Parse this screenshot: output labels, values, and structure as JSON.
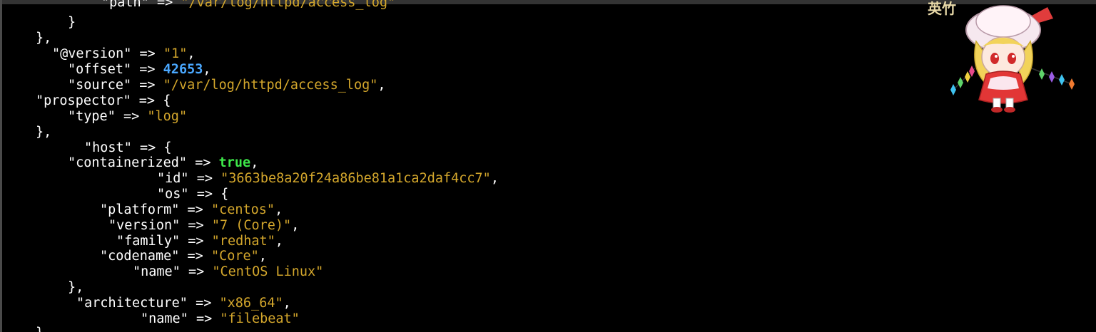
{
  "terminal": {
    "lines": [
      {
        "k": "\"path\"",
        "op": " => ",
        "v": "\"/var/log/httpd/access_log\"",
        "vt": "str",
        "p": ""
      },
      {
        "k": "}",
        "op": "",
        "v": "",
        "vt": "",
        "p": ""
      },
      {
        "k": "},",
        "op": "",
        "v": "",
        "vt": "",
        "p": ""
      },
      {
        "k": "\"@version\"",
        "op": " => ",
        "v": "\"1\"",
        "vt": "str",
        "p": ","
      },
      {
        "k": "\"offset\"",
        "op": " => ",
        "v": "42653",
        "vt": "num",
        "p": ","
      },
      {
        "k": "\"source\"",
        "op": " => ",
        "v": "\"/var/log/httpd/access_log\"",
        "vt": "str",
        "p": ","
      },
      {
        "k": "\"prospector\"",
        "op": " => ",
        "v": "",
        "vt": "",
        "p": "{"
      },
      {
        "k": "\"type\"",
        "op": " => ",
        "v": "\"log\"",
        "vt": "str",
        "p": ""
      },
      {
        "k": "},",
        "op": "",
        "v": "",
        "vt": "",
        "p": ""
      },
      {
        "k": "\"host\"",
        "op": " => ",
        "v": "",
        "vt": "",
        "p": "{"
      },
      {
        "k": "\"containerized\"",
        "op": " => ",
        "v": "true",
        "vt": "bool",
        "p": ","
      },
      {
        "k": "\"id\"",
        "op": " => ",
        "v": "\"3663be8a20f24a86be81a1ca2daf4cc7\"",
        "vt": "str",
        "p": ","
      },
      {
        "k": "\"os\"",
        "op": " => ",
        "v": "",
        "vt": "",
        "p": "{"
      },
      {
        "k": "\"platform\"",
        "op": " => ",
        "v": "\"centos\"",
        "vt": "str",
        "p": ","
      },
      {
        "k": "\"version\"",
        "op": " => ",
        "v": "\"7 (Core)\"",
        "vt": "str",
        "p": ","
      },
      {
        "k": "\"family\"",
        "op": " => ",
        "v": "\"redhat\"",
        "vt": "str",
        "p": ","
      },
      {
        "k": "\"codename\"",
        "op": " => ",
        "v": "\"Core\"",
        "vt": "str",
        "p": ","
      },
      {
        "k": "\"name\"",
        "op": " => ",
        "v": "\"CentOS Linux\"",
        "vt": "str",
        "p": ""
      },
      {
        "k": "},",
        "op": "",
        "v": "",
        "vt": "",
        "p": ""
      },
      {
        "k": "\"architecture\"",
        "op": " => ",
        "v": "\"x86_64\"",
        "vt": "str",
        "p": ","
      },
      {
        "k": "\"name\"",
        "op": " => ",
        "v": "\"filebeat\"",
        "vt": "str",
        "p": ""
      },
      {
        "k": "}",
        "op": "",
        "v": "",
        "vt": "",
        "p": ""
      }
    ]
  },
  "overlay": {
    "label": "英竹"
  },
  "colors": {
    "background": "#000000",
    "key": "#ffffff",
    "string": "#d4a72c",
    "number": "#4aa8ff",
    "boolean": "#3ee84a"
  }
}
